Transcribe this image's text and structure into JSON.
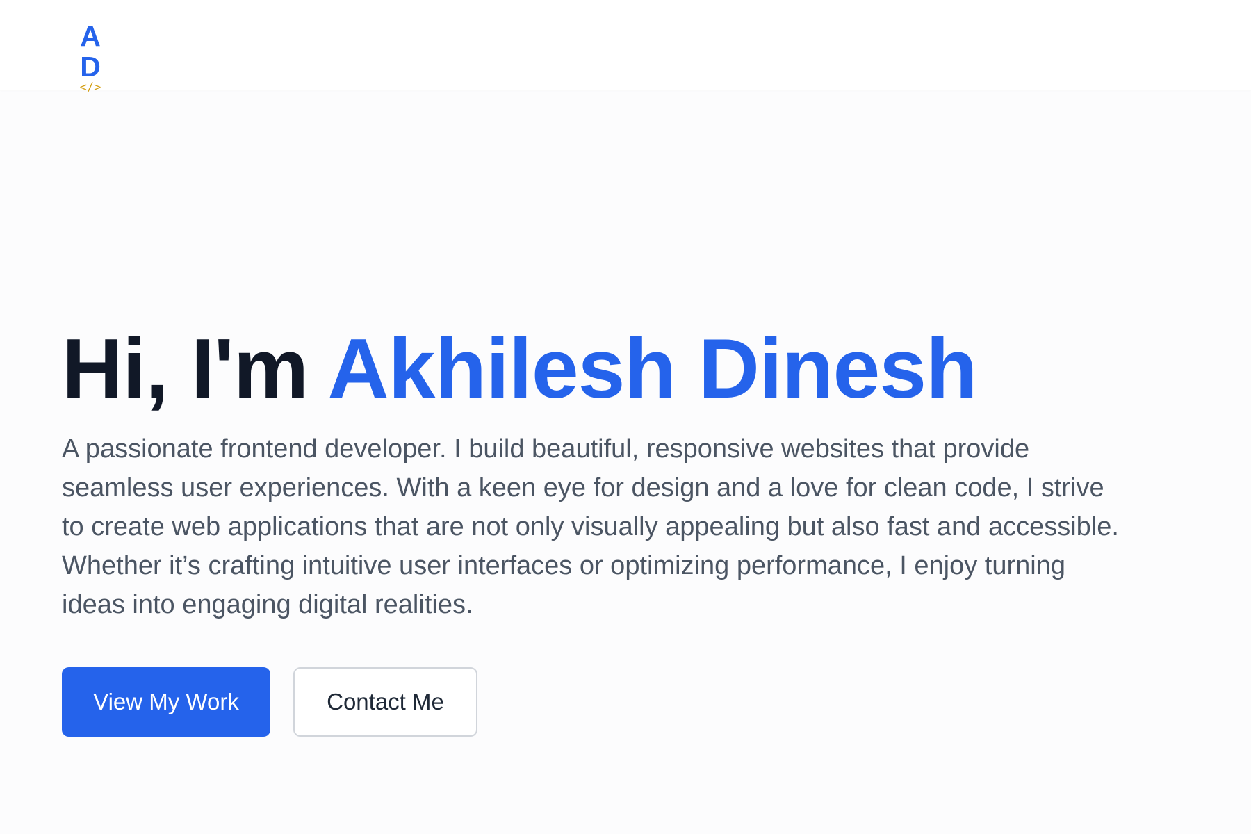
{
  "navbar": {
    "logo": {
      "initials": "A D",
      "code_symbol": "</>"
    }
  },
  "hero": {
    "greeting": "Hi, I'm ",
    "name": "Akhilesh Dinesh",
    "description": "A passionate frontend developer. I build beautiful, responsive websites that provide seamless user experiences. With a keen eye for design and a love for clean code, I strive to create web applications that are not only visually appealing but also fast and accessible. Whether it’s crafting intuitive user interfaces or optimizing performance, I enjoy turning ideas into engaging digital realities.",
    "primary_button": "View My Work",
    "secondary_button": "Contact Me"
  },
  "colors": {
    "accent": "#2563eb",
    "heading": "#111827",
    "body_text": "#4b5563",
    "logo_code": "#d4a017"
  }
}
